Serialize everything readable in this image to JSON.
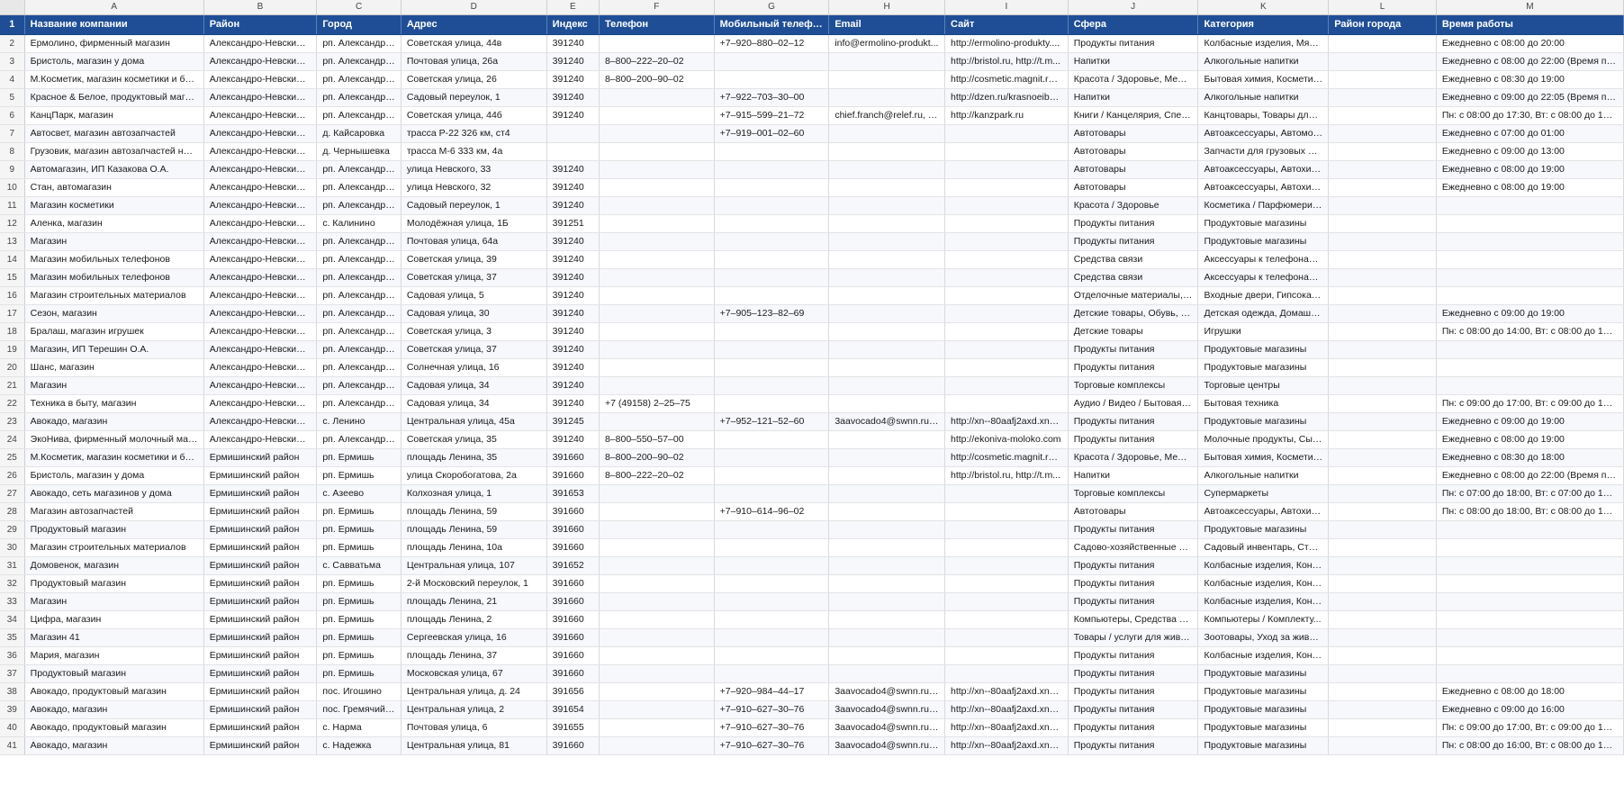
{
  "sheet": {
    "column_letters": [
      "A",
      "B",
      "C",
      "D",
      "E",
      "F",
      "G",
      "H",
      "I",
      "J",
      "K",
      "L",
      "M"
    ],
    "headers": [
      "Название компании",
      "Район",
      "Город",
      "Адрес",
      "Индекс",
      "Телефон",
      "Мобильный телефон",
      "Email",
      "Сайт",
      "Сфера",
      "Категория",
      "Район города",
      "Время работы"
    ],
    "header_row_number": "1",
    "rows": [
      {
        "n": "2",
        "c": [
          "Ермолино, фирменный магазин",
          "Александро-Невский р...",
          "рп. Александро...",
          "Советская улица, 44в",
          "391240",
          "",
          "+7–920–880–02–12",
          "info@ermolino-produkt...",
          "http://ermolino-produkty....",
          "Продукты питания",
          "Колбасные изделия, Мясо ...",
          "",
          "Ежедневно с 08:00 до 20:00"
        ]
      },
      {
        "n": "3",
        "c": [
          "Бристоль, магазин у дома",
          "Александро-Невский р...",
          "рп. Александро...",
          "Почтовая улица, 26а",
          "391240",
          "8–800–222–20–02",
          "",
          "",
          "http://bristol.ru, http://t.m...",
          "Напитки",
          "Алкогольные напитки",
          "",
          "Ежедневно с 08:00 до 22:00 (Время прода..."
        ]
      },
      {
        "n": "4",
        "c": [
          "М.Косметик, магазин косметики и бы...",
          "Александро-Невский р...",
          "рп. Александро...",
          "Советская улица, 26",
          "391240",
          "8–800–200–90–02",
          "",
          "",
          "http://cosmetic.magnit.ru,...",
          "Красота / Здоровье, Меди...",
          "Бытовая химия, Косметика...",
          "",
          "Ежедневно с 08:30 до 19:00"
        ]
      },
      {
        "n": "5",
        "c": [
          "Красное & Белое, продуктовый магаз...",
          "Александро-Невский р...",
          "рп. Александро...",
          "Садовый переулок, 1",
          "391240",
          "",
          "+7–922–703–30–00",
          "",
          "http://dzen.ru/krasnoeibel...",
          "Напитки",
          "Алкогольные напитки",
          "",
          "Ежедневно с 09:00 до 22:05 (Время прода..."
        ]
      },
      {
        "n": "6",
        "c": [
          "КанцПарк, магазин",
          "Александро-Невский р...",
          "рп. Александро...",
          "Советская улица, 44б",
          "391240",
          "",
          "+7–915–599–21–72",
          "chief.franch@relef.ru, in...",
          "http://kanzpark.ru",
          "Книги / Канцелярия, Спец...",
          "Канцтовары, Товары для т...",
          "",
          "Пн: с 08:00 до 17:30, Вт: с 08:00 до 17:30, С..."
        ]
      },
      {
        "n": "7",
        "c": [
          "Автосвет, магазин автозапчастей",
          "Александро-Невский р...",
          "д. Кайсаровка",
          "трасса Р-22 326 км, ст4",
          "",
          "",
          "+7–919–001–02–60",
          "",
          "",
          "Автотовары",
          "Автоаксессуары, Автомоб...",
          "",
          "Ежедневно с 07:00 до 01:00"
        ]
      },
      {
        "n": "8",
        "c": [
          "Грузовик, магазин автозапчастей на г...",
          "Александро-Невский р...",
          "д. Чернышевка",
          "трасса М-6 333 км, 4а",
          "",
          "",
          "",
          "",
          "",
          "Автотовары",
          "Запчасти для грузовых авт...",
          "",
          "Ежедневно с 09:00 до 13:00"
        ]
      },
      {
        "n": "9",
        "c": [
          "Автомагазин, ИП Казакова О.А.",
          "Александро-Невский р...",
          "рп. Александро...",
          "улица Невского, 33",
          "391240",
          "",
          "",
          "",
          "",
          "Автотовары",
          "Автоаксессуары, Автохими...",
          "",
          "Ежедневно с 08:00 до 19:00"
        ]
      },
      {
        "n": "10",
        "c": [
          "Стан, автомагазин",
          "Александро-Невский р...",
          "рп. Александро...",
          "улица Невского, 32",
          "391240",
          "",
          "",
          "",
          "",
          "Автотовары",
          "Автоаксессуары, Автохими...",
          "",
          "Ежедневно с 08:00 до 19:00"
        ]
      },
      {
        "n": "11",
        "c": [
          "Магазин косметики",
          "Александро-Невский р...",
          "рп. Александро...",
          "Садовый переулок, 1",
          "391240",
          "",
          "",
          "",
          "",
          "Красота / Здоровье",
          "Косметика / Парфюмерия,...",
          "",
          ""
        ]
      },
      {
        "n": "12",
        "c": [
          "Аленка, магазин",
          "Александро-Невский р...",
          "с. Калинино",
          "Молодёжная улица, 1Б",
          "391251",
          "",
          "",
          "",
          "",
          "Продукты питания",
          "Продуктовые магазины",
          "",
          ""
        ]
      },
      {
        "n": "13",
        "c": [
          "Магазин",
          "Александро-Невский р...",
          "рп. Александро...",
          "Почтовая улица, 64а",
          "391240",
          "",
          "",
          "",
          "",
          "Продукты питания",
          "Продуктовые магазины",
          "",
          ""
        ]
      },
      {
        "n": "14",
        "c": [
          "Магазин мобильных телефонов",
          "Александро-Невский р...",
          "рп. Александро...",
          "Советская улица, 39",
          "391240",
          "",
          "",
          "",
          "",
          "Средства связи",
          "Аксессуары к телефонам, ...",
          "",
          ""
        ]
      },
      {
        "n": "15",
        "c": [
          "Магазин мобильных телефонов",
          "Александро-Невский р...",
          "рп. Александро...",
          "Советская улица, 37",
          "391240",
          "",
          "",
          "",
          "",
          "Средства связи",
          "Аксессуары к телефонам, ...",
          "",
          ""
        ]
      },
      {
        "n": "16",
        "c": [
          "Магазин строительных материалов",
          "Александро-Невский р...",
          "рп. Александро...",
          "Садовая улица, 5",
          "391240",
          "",
          "",
          "",
          "",
          "Отделочные материалы, С...",
          "Входные двери, Гипсокарт...",
          "",
          ""
        ]
      },
      {
        "n": "17",
        "c": [
          "Сезон, магазин",
          "Александро-Невский р...",
          "рп. Александро...",
          "Садовая улица, 30",
          "391240",
          "",
          "+7–905–123–82–69",
          "",
          "",
          "Детские товары, Обувь, О...",
          "Детская одежда, Домашни...",
          "",
          "Ежедневно с 09:00 до 19:00"
        ]
      },
      {
        "n": "18",
        "c": [
          "Бралаш, магазин игрушек",
          "Александро-Невский р...",
          "рп. Александро...",
          "Советская улица, 3",
          "391240",
          "",
          "",
          "",
          "",
          "Детские товары",
          "Игрушки",
          "",
          "Пн: с 08:00 до 14:00, Вт: с 08:00 до 14:00, С..."
        ]
      },
      {
        "n": "19",
        "c": [
          "Магазин, ИП Терешин О.А.",
          "Александро-Невский р...",
          "рп. Александро...",
          "Советская улица, 37",
          "391240",
          "",
          "",
          "",
          "",
          "Продукты питания",
          "Продуктовые магазины",
          "",
          ""
        ]
      },
      {
        "n": "20",
        "c": [
          "Шанс, магазин",
          "Александро-Невский р...",
          "рп. Александро...",
          "Солнечная улица, 16",
          "391240",
          "",
          "",
          "",
          "",
          "Продукты питания",
          "Продуктовые магазины",
          "",
          ""
        ]
      },
      {
        "n": "21",
        "c": [
          "Магазин",
          "Александро-Невский р...",
          "рп. Александро...",
          "Садовая улица, 34",
          "391240",
          "",
          "",
          "",
          "",
          "Торговые комплексы",
          "Торговые центры",
          "",
          ""
        ]
      },
      {
        "n": "22",
        "c": [
          "Техника в быту, магазин",
          "Александро-Невский р...",
          "рп. Александро...",
          "Садовая улица, 34",
          "391240",
          "+7 (49158) 2–25–75",
          "",
          "",
          "",
          "Аудио / Видео / Бытовая т...",
          "Бытовая техника",
          "",
          "Пн: с 09:00 до 17:00, Вт: с 09:00 до 17:00, С..."
        ]
      },
      {
        "n": "23",
        "c": [
          "Авокадо, магазин",
          "Александро-Невский р...",
          "с. Ленино",
          "Центральная улица, 45а",
          "391245",
          "",
          "+7–952–121–52–60",
          "3aavocado4@swnn.ru, a...",
          "http://xn--80aafj2axd.xn--...",
          "Продукты питания",
          "Продуктовые магазины",
          "",
          "Ежедневно с 09:00 до 19:00"
        ]
      },
      {
        "n": "24",
        "c": [
          "ЭкоНива, фирменный молочный маг...",
          "Александро-Невский р...",
          "рп. Александро...",
          "Советская улица, 35",
          "391240",
          "8–800–550–57–00",
          "",
          "",
          "http://ekoniva-moloko.com",
          "Продукты питания",
          "Молочные продукты, Сыры",
          "",
          "Ежедневно с 08:00 до 19:00"
        ]
      },
      {
        "n": "25",
        "c": [
          "М.Косметик, магазин косметики и бы...",
          "Ермишинский район",
          "рп. Ермишь",
          "площадь Ленина, 35",
          "391660",
          "8–800–200–90–02",
          "",
          "",
          "http://cosmetic.magnit.ru,...",
          "Красота / Здоровье, Меди...",
          "Бытовая химия, Косметика...",
          "",
          "Ежедневно с 08:30 до 18:00"
        ]
      },
      {
        "n": "26",
        "c": [
          "Бристоль, магазин у дома",
          "Ермишинский район",
          "рп. Ермишь",
          "улица Скоробогатова, 2а",
          "391660",
          "8–800–222–20–02",
          "",
          "",
          "http://bristol.ru, http://t.m...",
          "Напитки",
          "Алкогольные напитки",
          "",
          "Ежедневно с 08:00 до 22:00 (Время прода..."
        ]
      },
      {
        "n": "27",
        "c": [
          "Авокадо, сеть магазинов у дома",
          "Ермишинский район",
          "с. Азеево",
          "Колхозная улица, 1",
          "391653",
          "",
          "",
          "",
          "",
          "Торговые комплексы",
          "Супермаркеты",
          "",
          "Пн: с 07:00 до 18:00, Вт: с 07:00 до 18:00, С..."
        ]
      },
      {
        "n": "28",
        "c": [
          "Магазин автозапчастей",
          "Ермишинский район",
          "рп. Ермишь",
          "площадь Ленина, 59",
          "391660",
          "",
          "+7–910–614–96–02",
          "",
          "",
          "Автотовары",
          "Автоаксессуары, Автохими...",
          "",
          "Пн: с 08:00 до 18:00, Вт: с 08:00 до 18:00, С..."
        ]
      },
      {
        "n": "29",
        "c": [
          "Продуктовый магазин",
          "Ермишинский район",
          "рп. Ермишь",
          "площадь Ленина, 59",
          "391660",
          "",
          "",
          "",
          "",
          "Продукты питания",
          "Продуктовые магазины",
          "",
          ""
        ]
      },
      {
        "n": "30",
        "c": [
          "Магазин строительных материалов",
          "Ермишинский район",
          "рп. Ермишь",
          "площадь Ленина, 10а",
          "391660",
          "",
          "",
          "",
          "",
          "Садово-хозяйственные то...",
          "Садовый инвентарь, Стро...",
          "",
          ""
        ]
      },
      {
        "n": "31",
        "c": [
          "Домовенок, магазин",
          "Ермишинский район",
          "с. Савватьма",
          "Центральная улица, 107",
          "391652",
          "",
          "",
          "",
          "",
          "Продукты питания",
          "Колбасные изделия, Конд...",
          "",
          ""
        ]
      },
      {
        "n": "32",
        "c": [
          "Продуктовый магазин",
          "Ермишинский район",
          "рп. Ермишь",
          "2-й Московский переулок, 1",
          "391660",
          "",
          "",
          "",
          "",
          "Продукты питания",
          "Колбасные изделия, Конд...",
          "",
          ""
        ]
      },
      {
        "n": "33",
        "c": [
          "Магазин",
          "Ермишинский район",
          "рп. Ермишь",
          "площадь Ленина, 21",
          "391660",
          "",
          "",
          "",
          "",
          "Продукты питания",
          "Колбасные изделия, Конд...",
          "",
          ""
        ]
      },
      {
        "n": "34",
        "c": [
          "Цифра, магазин",
          "Ермишинский район",
          "рп. Ермишь",
          "площадь Ленина, 2",
          "391660",
          "",
          "",
          "",
          "",
          "Компьютеры, Средства ав...",
          "Компьютеры / Комплекту...",
          "",
          ""
        ]
      },
      {
        "n": "35",
        "c": [
          "Магазин 41",
          "Ермишинский район",
          "рп. Ермишь",
          "Сергеевская улица, 16",
          "391660",
          "",
          "",
          "",
          "",
          "Товары / услуги для живот...",
          "Зоотовары, Уход за живот...",
          "",
          ""
        ]
      },
      {
        "n": "36",
        "c": [
          "Мария, магазин",
          "Ермишинский район",
          "рп. Ермишь",
          "площадь Ленина, 37",
          "391660",
          "",
          "",
          "",
          "",
          "Продукты питания",
          "Колбасные изделия, Конд...",
          "",
          ""
        ]
      },
      {
        "n": "37",
        "c": [
          "Продуктовый магазин",
          "Ермишинский район",
          "рп. Ермишь",
          "Московская улица, 67",
          "391660",
          "",
          "",
          "",
          "",
          "Продукты питания",
          "Продуктовые магазины",
          "",
          ""
        ]
      },
      {
        "n": "38",
        "c": [
          "Авокадо, продуктовый магазин",
          "Ермишинский район",
          "пос. Игошино",
          "Центральная улица, д. 24",
          "391656",
          "",
          "+7–920–984–44–17",
          "3aavocado4@swnn.ru, a...",
          "http://xn--80aafj2axd.xn--...",
          "Продукты питания",
          "Продуктовые магазины",
          "",
          "Ежедневно с 08:00 до 18:00"
        ]
      },
      {
        "n": "39",
        "c": [
          "Авокадо, магазин",
          "Ермишинский район",
          "пос. Гремячий ...",
          "Центральная улица, 2",
          "391654",
          "",
          "+7–910–627–30–76",
          "3aavocado4@swnn.ru, a...",
          "http://xn--80aafj2axd.xn--...",
          "Продукты питания",
          "Продуктовые магазины",
          "",
          "Ежедневно с 09:00 до 16:00"
        ]
      },
      {
        "n": "40",
        "c": [
          "Авокадо, продуктовый магазин",
          "Ермишинский район",
          "с. Нарма",
          "Почтовая улица, 6",
          "391655",
          "",
          "+7–910–627–30–76",
          "3aavocado4@swnn.ru, a...",
          "http://xn--80aafj2axd.xn--...",
          "Продукты питания",
          "Продуктовые магазины",
          "",
          "Пн: с 09:00 до 17:00, Вт: с 09:00 до 17:00, С..."
        ]
      },
      {
        "n": "41",
        "c": [
          "Авокадо, магазин",
          "Ермишинский район",
          "с. Надежка",
          "Центральная улица, 81",
          "391660",
          "",
          "+7–910–627–30–76",
          "3aavocado4@swnn.ru, a...",
          "http://xn--80aafj2axd.xn--...",
          "Продукты питания",
          "Продуктовые магазины",
          "",
          "Пн: с 08:00 до 16:00, Вт: с 08:00 до 16:00, С..."
        ]
      }
    ]
  }
}
